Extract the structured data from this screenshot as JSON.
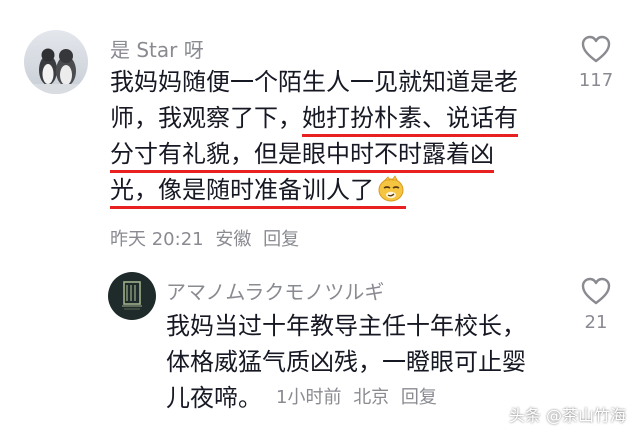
{
  "comments": [
    {
      "username": "是 Star 呀",
      "lines": [
        [
          "我妈妈随便一个陌生人一见就知道是老"
        ],
        [
          "师，我观察了下，",
          "她打扮朴素、说话有"
        ],
        [
          "分寸有礼貌，但是眼中时不时露着凶"
        ],
        [
          "光，像是随时准备训人了"
        ]
      ],
      "emoji_icon": "smirk-face-emoji",
      "meta": {
        "time": "昨天 20:21",
        "location": "安徽",
        "reply": "回复"
      },
      "likes": "117"
    },
    {
      "username": "アマノムラクモノツルギ",
      "lines": [
        [
          "我妈当过十年教导主任十年校长，"
        ],
        [
          "体格威猛气质凶残，一瞪眼可止婴"
        ],
        [
          "儿夜啼。"
        ]
      ],
      "meta": {
        "time": "1小时前",
        "location": "北京",
        "reply": "回复"
      },
      "likes": "21"
    }
  ],
  "watermark": "头条 @茶山竹海",
  "colors": {
    "underline": "#e8201f",
    "muted": "#8a8b91",
    "text": "#161823"
  }
}
